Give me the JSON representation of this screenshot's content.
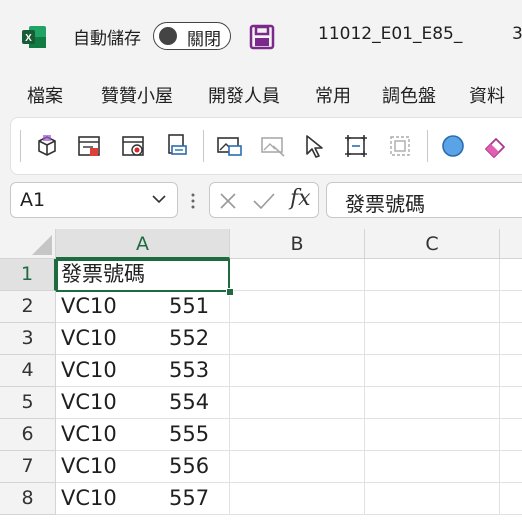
{
  "titlebar": {
    "autosave_label": "自動儲存",
    "autosave_state": "關閉",
    "document_title": "11012_E01_E85_",
    "document_title_more": "3"
  },
  "tabs": [
    "檔案",
    "贊贊小屋",
    "開發人員",
    "常用",
    "調色盤",
    "資料"
  ],
  "formula_bar": {
    "name_box": "A1",
    "fx_label": "fx",
    "content": "發票號碼"
  },
  "columns": [
    "A",
    "B",
    "C"
  ],
  "rows": [
    {
      "num": "1",
      "a": "發票號碼",
      "a2": ""
    },
    {
      "num": "2",
      "a": "VC10",
      "a2": "551"
    },
    {
      "num": "3",
      "a": "VC10",
      "a2": "552"
    },
    {
      "num": "4",
      "a": "VC10",
      "a2": "553"
    },
    {
      "num": "5",
      "a": "VC10",
      "a2": "554"
    },
    {
      "num": "6",
      "a": "VC10",
      "a2": "555"
    },
    {
      "num": "7",
      "a": "VC10",
      "a2": "556"
    },
    {
      "num": "8",
      "a": "VC10",
      "a2": "557"
    }
  ],
  "colors": {
    "accent": "#1e6b3f",
    "excel_green": "#107c41",
    "save_purple": "#7a2a8a"
  }
}
